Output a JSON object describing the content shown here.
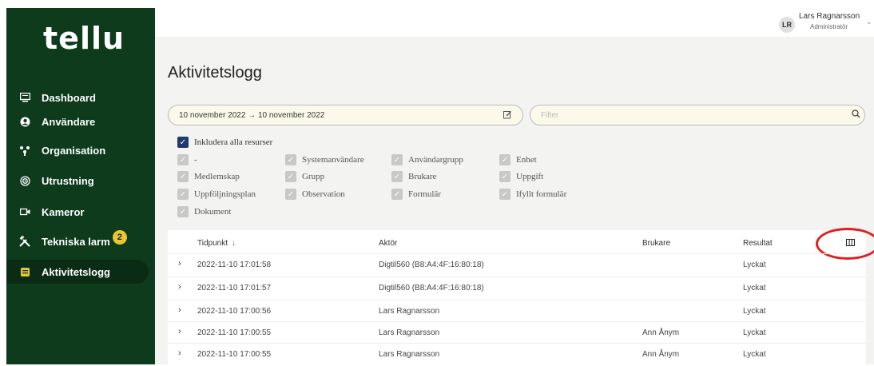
{
  "sidebar": {
    "logo": "tellu",
    "items": [
      {
        "label": "Dashboard",
        "icon": "monitor-icon"
      },
      {
        "label": "Användare",
        "icon": "user-icon"
      },
      {
        "label": "Organisation",
        "icon": "org-icon"
      },
      {
        "label": "Utrustning",
        "icon": "signal-icon"
      },
      {
        "label": "Kameror",
        "icon": "camera-icon"
      },
      {
        "label": "Tekniska larm",
        "icon": "tools-icon",
        "badge": "2"
      },
      {
        "label": "Aktivitetslogg",
        "icon": "log-icon"
      }
    ]
  },
  "user": {
    "initials": "LR",
    "name": "Lars Ragnarsson",
    "role": "Administratör"
  },
  "page": {
    "title": "Aktivitetslogg",
    "date_range": "10 november 2022 → 10 november 2022",
    "filter_placeholder": "Filter"
  },
  "checkboxes": {
    "include_all": "Inkludera alla resurser",
    "options": [
      "-",
      "Systemanvändare",
      "Användargrupp",
      "Enhet",
      "Medlemskap",
      "Grupp",
      "Brukare",
      "Uppgift",
      "Uppföljningsplan",
      "Observation",
      "Formulär",
      "Ifyllt formulär",
      "Dokument"
    ]
  },
  "table": {
    "headers": {
      "time": "Tidpunkt",
      "actor": "Aktör",
      "client": "Brukare",
      "result": "Resultat"
    },
    "rows": [
      {
        "time": "2022-11-10 17:01:58",
        "actor": "Digtil560 (B8:A4:4F:16:80:18)",
        "client": "",
        "result": "Lyckat"
      },
      {
        "time": "2022-11-10 17:01:57",
        "actor": "Digtil560 (B8:A4:4F:16:80:18)",
        "client": "",
        "result": "Lyckat"
      },
      {
        "time": "2022-11-10 17:00:56",
        "actor": "Lars Ragnarsson",
        "client": "",
        "result": "Lyckat"
      },
      {
        "time": "2022-11-10 17:00:55",
        "actor": "Lars Ragnarsson",
        "client": "Ann Ånym",
        "result": "Lyckat"
      },
      {
        "time": "2022-11-10 17:00:55",
        "actor": "Lars Ragnarsson",
        "client": "Ann Ånym",
        "result": "Lyckat"
      }
    ]
  },
  "colors": {
    "sidebar": "#0d3b1c",
    "accent": "#1f3a6e",
    "badge": "#e8c832",
    "annotation": "#e01e1e"
  }
}
